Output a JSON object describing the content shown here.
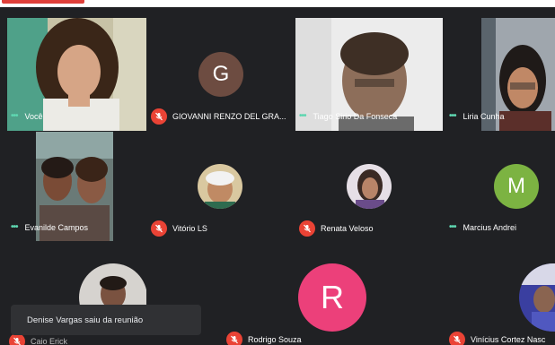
{
  "participants": [
    {
      "name": "Você",
      "muted": false
    },
    {
      "name": "GIOVANNI RENZO DEL GRA...",
      "muted": true,
      "initial": "G"
    },
    {
      "name": "Tiago Sirio Da Fonseca",
      "muted": false
    },
    {
      "name": "Liria Cunha",
      "muted": false
    },
    {
      "name": "Evanilde Campos",
      "muted": false
    },
    {
      "name": "Vitório LS",
      "muted": true
    },
    {
      "name": "Renata Veloso",
      "muted": true
    },
    {
      "name": "Marcius Andrei",
      "muted": false,
      "initial": "M"
    },
    {
      "name": "Caio Erick",
      "muted": true
    },
    {
      "name": "Rodrigo Souza",
      "muted": true,
      "initial": "R"
    },
    {
      "name": "Vinícius Cortez Nasc",
      "muted": true
    }
  ],
  "notification": "Denise Vargas saiu da reunião",
  "colors": {
    "background": "#202124",
    "mic_muted": "#ea4335",
    "speaking_dots": "#5ed6b0",
    "avatar_g": "#6d4c41",
    "avatar_m": "#7cb342",
    "avatar_r": "#ec407a"
  }
}
